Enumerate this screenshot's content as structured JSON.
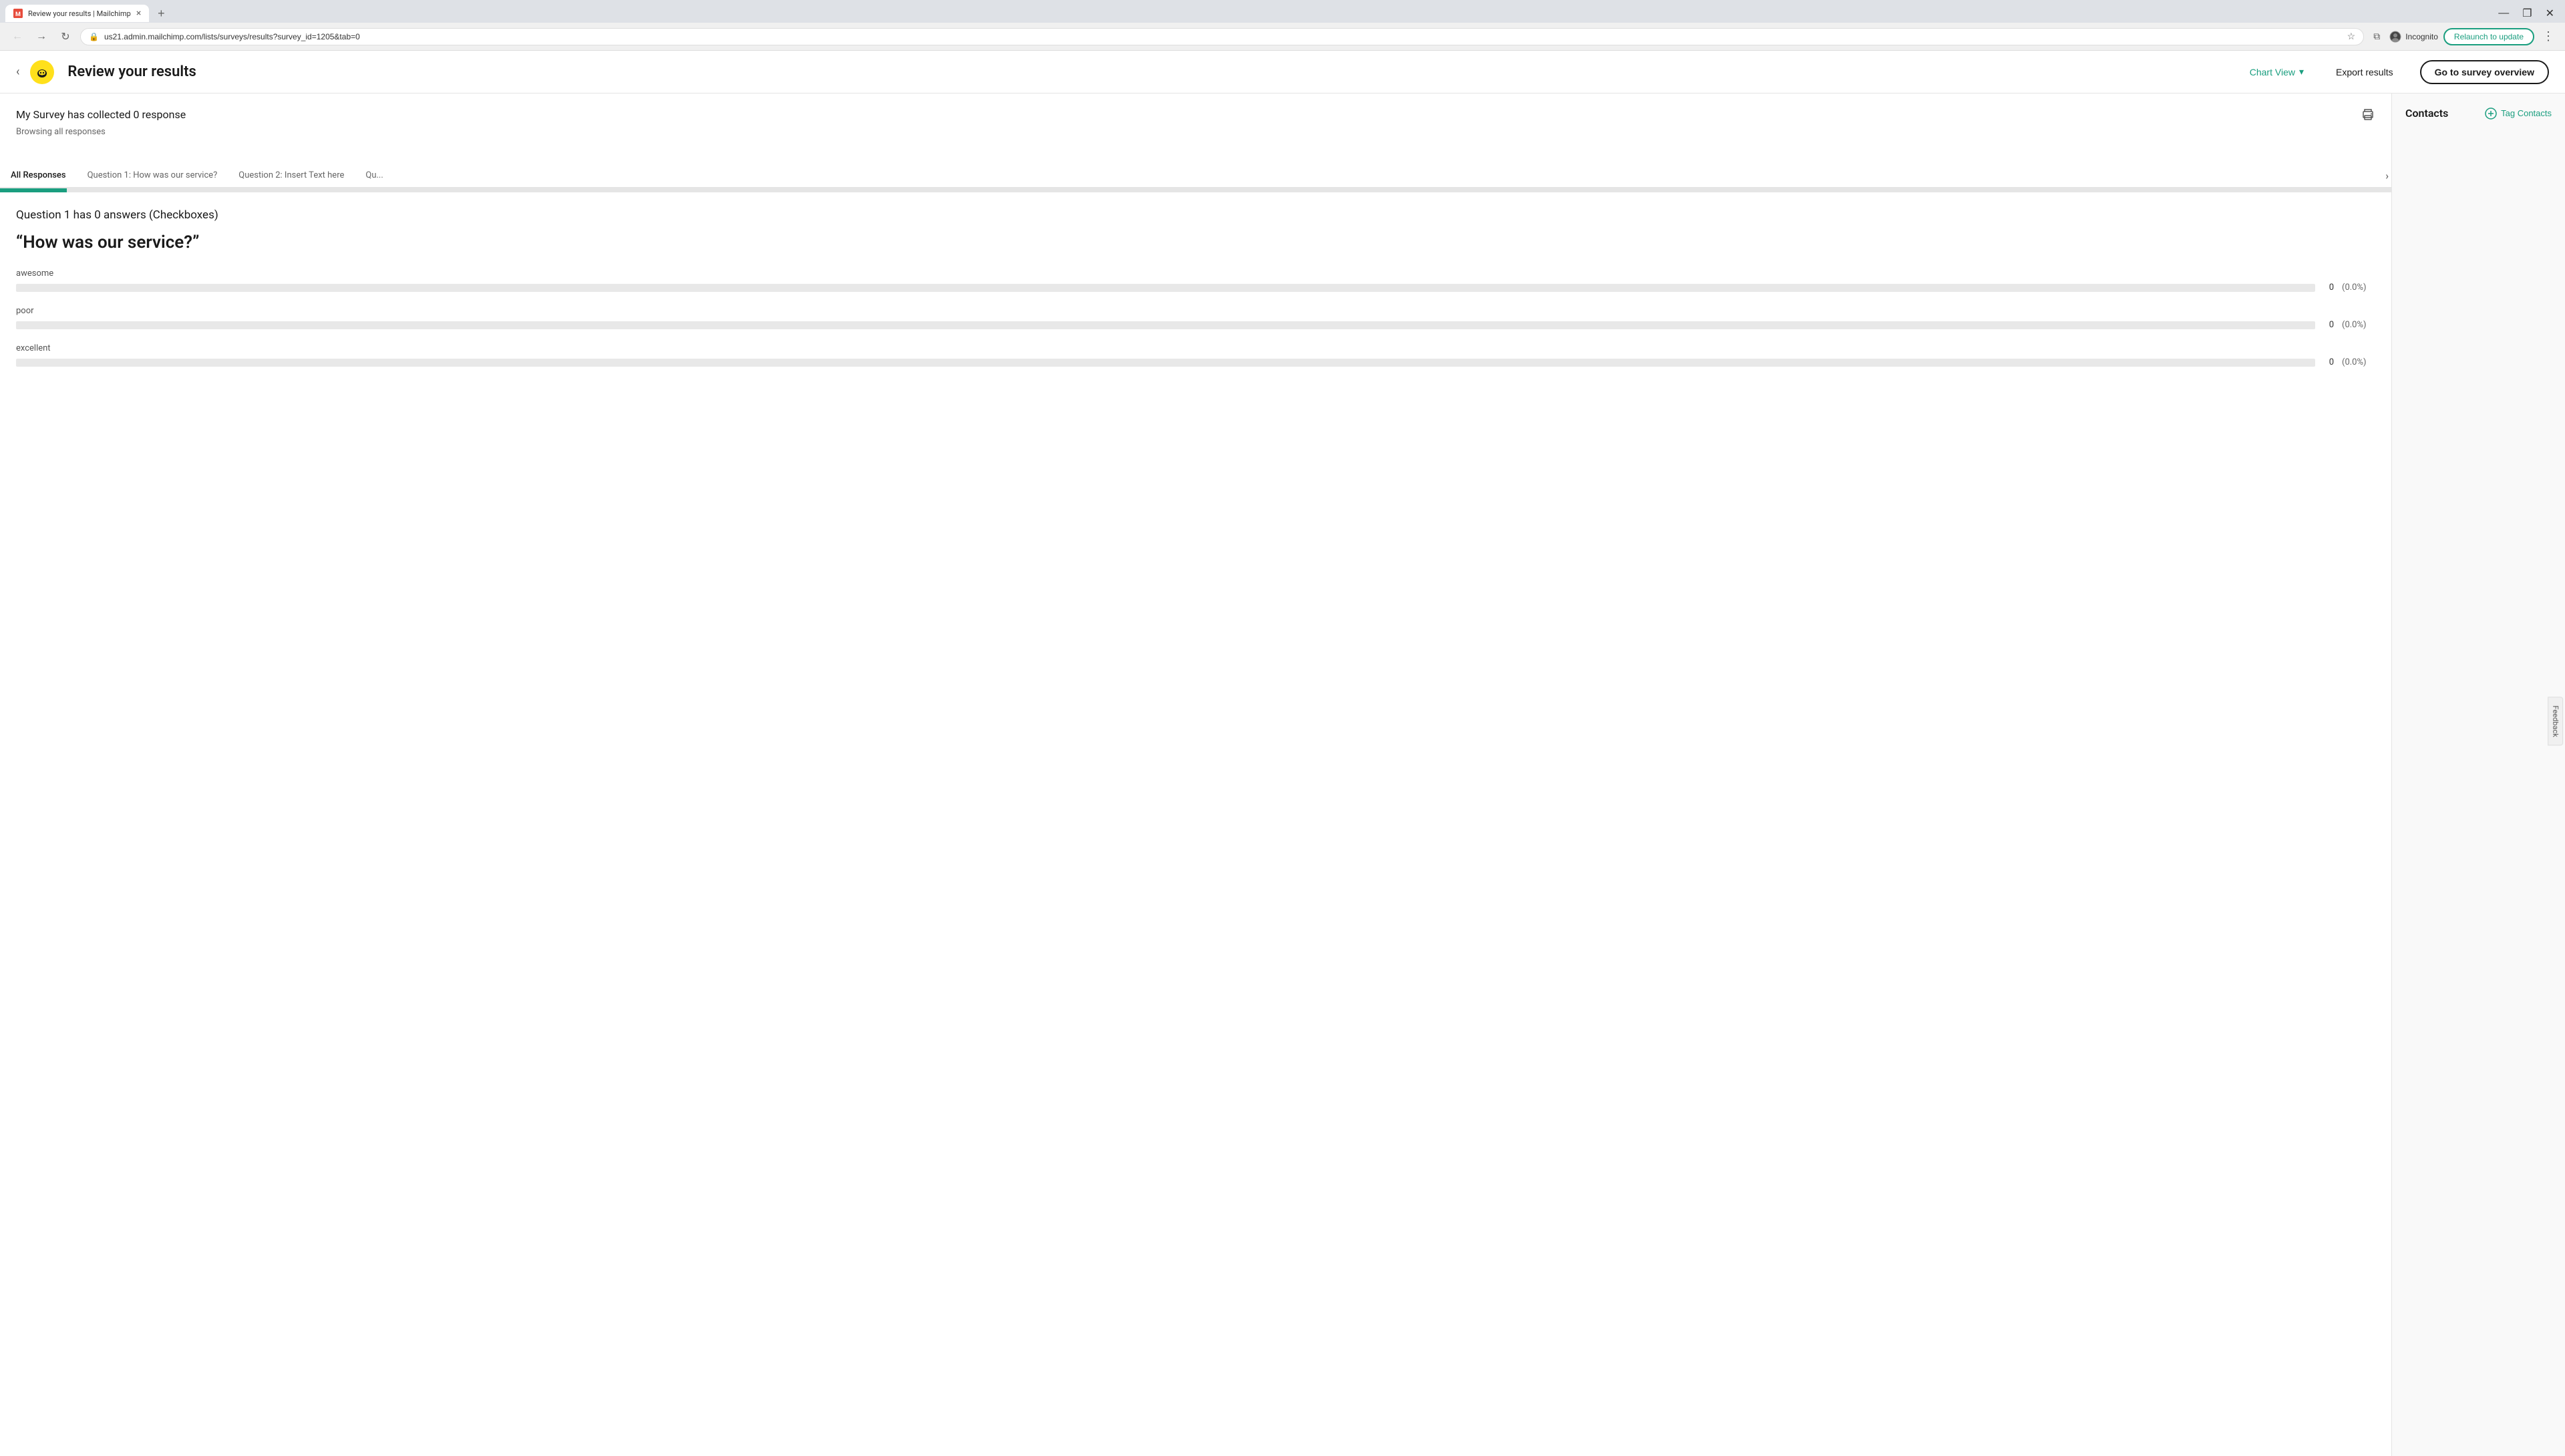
{
  "browser": {
    "tab": {
      "favicon": "M",
      "title": "Review your results | Mailchimp",
      "close_label": "×"
    },
    "new_tab_label": "+",
    "window_controls": {
      "minimize": "—",
      "maximize": "❐",
      "close": "✕"
    },
    "url": "us21.admin.mailchimp.com/lists/surveys/results?survey_id=1205&tab=0",
    "incognito_label": "Incognito",
    "relaunch_label": "Relaunch to update"
  },
  "header": {
    "back_icon": "‹",
    "page_title": "Review your results",
    "chart_view_label": "Chart View",
    "export_label": "Export results",
    "survey_overview_label": "Go to survey overview"
  },
  "survey": {
    "summary_text": "My Survey has collected 0 response",
    "browsing_text": "Browsing all responses",
    "print_icon": "🖨"
  },
  "tabs": [
    {
      "label": "All Responses",
      "active": true
    },
    {
      "label": "Question 1: How was our service?",
      "active": false
    },
    {
      "label": "Question 2: Insert Text here",
      "active": false
    },
    {
      "label": "Qu...",
      "active": false
    }
  ],
  "question": {
    "header": "Question 1 has 0 answers (Checkboxes)",
    "title": "“How was our service?”",
    "answers": [
      {
        "label": "awesome",
        "count": "0",
        "pct": "(0.0%)"
      },
      {
        "label": "poor",
        "count": "0",
        "pct": "(0.0%)"
      },
      {
        "label": "excellent",
        "count": "0",
        "pct": "(0.0%)"
      }
    ]
  },
  "sidebar": {
    "title": "Contacts",
    "tag_contacts_label": "Tag Contacts",
    "tag_icon": "⊕"
  },
  "feedback": {
    "label": "Feedback"
  },
  "colors": {
    "teal": "#1a9e7f",
    "border": "#e5e5e5",
    "bar_bg": "#e8e8e8",
    "text_primary": "#1a1a1a",
    "text_secondary": "#666"
  }
}
